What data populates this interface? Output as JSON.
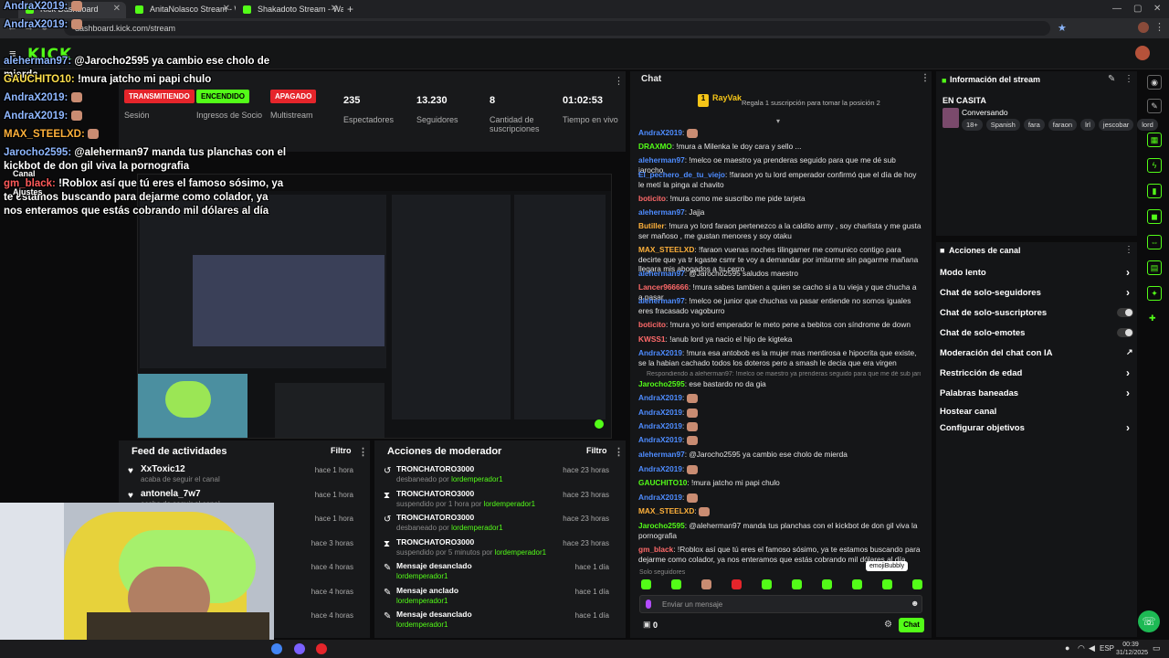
{
  "browser": {
    "tabs": [
      {
        "label": "Kick Dashboard"
      },
      {
        "label": "AnitaNolasco Stream - Watch L"
      },
      {
        "label": "Shakadoto Stream - Watch"
      }
    ],
    "url": "dashboard.kick.com/stream",
    "new_tab_symbol": "+"
  },
  "kick": {
    "logo": "KICK"
  },
  "stats": {
    "session": {
      "badge": "TRANSMITIENDO",
      "label": "Sesión"
    },
    "partner": {
      "badge": "ENCENDIDO",
      "label": "Ingresos de Socio"
    },
    "multistream": {
      "badge": "APAGADO",
      "label": "Multistream"
    },
    "viewers": {
      "value": "235",
      "label": "Espectadores"
    },
    "followers": {
      "value": "13.230",
      "label": "Seguidores"
    },
    "subs": {
      "value": "8",
      "label": "Cantidad de suscripciones"
    },
    "live_time": {
      "value": "01:02:53",
      "label": "Tiempo en vivo"
    }
  },
  "activity_feed": {
    "title": "Feed de actividades",
    "filter": "Filtro",
    "items": [
      {
        "name": "XxToxic12",
        "sub": "acaba de seguir el canal",
        "time": "hace 1 hora"
      },
      {
        "name": "antonela_7w7",
        "sub": "acaba de seguir el canal",
        "time": "hace 1 hora"
      },
      {
        "name": "",
        "sub": "",
        "time": "hace 1 hora"
      },
      {
        "name": "",
        "sub": "",
        "time": "hace 3 horas"
      },
      {
        "name": "",
        "sub": "",
        "time": "hace 4 horas"
      },
      {
        "name": "",
        "sub": "",
        "time": "hace 4 horas"
      },
      {
        "name": "",
        "sub": "",
        "time": "hace 4 horas"
      }
    ]
  },
  "mod_actions": {
    "title": "Acciones de moderador",
    "filter": "Filtro",
    "items": [
      {
        "title": "TRONCHATORO3000",
        "sub": "desbaneado por",
        "by": "lordemperador1",
        "time": "hace 23 horas"
      },
      {
        "title": "TRONCHATORO3000",
        "sub": "suspendido por 1 hora por",
        "by": "lordemperador1",
        "time": "hace 23 horas"
      },
      {
        "title": "TRONCHATORO3000",
        "sub": "desbaneado por",
        "by": "lordemperador1",
        "time": "hace 23 horas"
      },
      {
        "title": "TRONCHATORO3000",
        "sub": "suspendido por 5 minutos por",
        "by": "lordemperador1",
        "time": "hace 23 horas"
      },
      {
        "title": "Mensaje desanclado",
        "sub": "",
        "by": "lordemperador1",
        "time": "hace 1 día"
      },
      {
        "title": "Mensaje anclado",
        "sub": "",
        "by": "lordemperador1",
        "time": "hace 1 día"
      },
      {
        "title": "Mensaje desanclado",
        "sub": "",
        "by": "lordemperador1",
        "time": "hace 1 día"
      }
    ]
  },
  "chat": {
    "title": "Chat",
    "top_user": "RayVak",
    "top_rank": "1",
    "gift_prompt": "Regala 1 suscripción para tomar la posición 2",
    "messages": [
      {
        "user": "AndraX2019",
        "color": "#4e8cff",
        "text": ""
      },
      {
        "user": "DRAXMO",
        "color": "#53fc18",
        "text": "!mura a Milenka le doy cara y sello ..."
      },
      {
        "user": "aleherman97",
        "color": "#4e8cff",
        "text": "!melco oe maestro ya prenderas seguido para que me dé sub jarocho"
      },
      {
        "user": "El_pechero_de_tu_viejo",
        "color": "#4e8cff",
        "text": "!faraon yo tu lord emperador confirmó que el día de hoy le metí la pinga al chavito"
      },
      {
        "user": "boticito",
        "color": "#ff6a6a",
        "text": "!mura como me suscribo me pide tarjeta"
      },
      {
        "user": "aleherman97",
        "color": "#4e8cff",
        "text": "Jajja"
      },
      {
        "user": "Butiller",
        "color": "#ffb13b",
        "text": "!mura yo lord faraon pertenezco a la caldito army , soy charlista y me gusta ser mañoso , me gustan menores y soy otaku"
      },
      {
        "user": "MAX_STEELXD",
        "color": "#ffb13b",
        "text": "!faraon vuenas noches tilingamer me comunico contigo para decirte que ya tr kgaste csmr te voy a demandar por imitarme sin pagarme mañana llegara mis abogados a tu cerro"
      },
      {
        "user": "aleherman97",
        "color": "#4e8cff",
        "text": "@Jarocho2595 saludos maestro"
      },
      {
        "user": "Lancer966666",
        "color": "#ff6a6a",
        "text": "!mura sabes tambien a quien se cacho si a tu vieja y que chucha a a pasar"
      },
      {
        "user": "aleherman97",
        "color": "#4e8cff",
        "text": "!melco oe junior que chuchas va pasar entiende no somos iguales eres fracasado vagoburro"
      },
      {
        "user": "boticito",
        "color": "#ff6a6a",
        "text": "!mura yo lord emperador le meto pene a bebitos con síndrome de down"
      },
      {
        "user": "KWSS1",
        "color": "#ff6a6a",
        "text": "!anub lord ya nacio el hijo de kigteka"
      },
      {
        "user": "AndraX2019",
        "color": "#4e8cff",
        "text": "!mura esa antobob es la mujer mas mentirosa e hipocrita que existe, se la habian cachado todos los doteros pero a smash le decia que era virgen"
      },
      {
        "user": "Jarocho2595",
        "color": "#53fc18",
        "text": "ese bastardo no da gia"
      },
      {
        "user": "AndraX2019",
        "color": "#4e8cff",
        "text": ""
      },
      {
        "user": "AndraX2019",
        "color": "#4e8cff",
        "text": ""
      },
      {
        "user": "AndraX2019",
        "color": "#4e8cff",
        "text": ""
      },
      {
        "user": "AndraX2019",
        "color": "#4e8cff",
        "text": ""
      },
      {
        "user": "aleherman97",
        "color": "#4e8cff",
        "text": "@Jarocho2595 ya cambio ese cholo de mierda"
      },
      {
        "user": "AndraX2019",
        "color": "#4e8cff",
        "text": ""
      },
      {
        "user": "GAUCHITO10",
        "color": "#53fc18",
        "text": "!mura jatcho mi papi chulo"
      },
      {
        "user": "AndraX2019",
        "color": "#4e8cff",
        "text": ""
      },
      {
        "user": "MAX_STEELXD",
        "color": "#ffb13b",
        "text": ""
      },
      {
        "user": "Jarocho2595",
        "color": "#53fc18",
        "text": "@aleherman97 manda tus planchas con el kickbot de don gil viva la pornografia"
      },
      {
        "user": "gm_black",
        "color": "#ff6a6a",
        "text": "!Roblox así que tú eres el famoso sósimo, ya te estamos buscando para dejarme como colador, ya nos enteramos que estás cobrando mil dólares al día"
      }
    ],
    "reply_note": "Respondiendo a aleherman97: !melco oe maestro ya prenderas seguido para que me dé sub jarocho",
    "followers_only": "Solo seguidores",
    "emote_tooltip": "emojiBubbly",
    "input_placeholder": "Enviar un mensaje",
    "send_label": "Chat",
    "counter": "0"
  },
  "stream_info": {
    "title": "Información del stream",
    "status": "EN CASITA",
    "category": "Conversando",
    "tags": [
      "18+",
      "Spanish",
      "fara",
      "faraon",
      "lrl",
      "jescobar",
      "lord"
    ]
  },
  "channel_actions": {
    "title": "Acciones de canal",
    "items": [
      {
        "label": "Modo lento",
        "control": "chevron"
      },
      {
        "label": "Chat de solo-seguidores",
        "control": "chevron"
      },
      {
        "label": "Chat de solo-suscriptores",
        "control": "toggle"
      },
      {
        "label": "Chat de solo-emotes",
        "control": "toggle"
      },
      {
        "label": "Moderación del chat con IA",
        "control": "link"
      },
      {
        "label": "Restricción de edad",
        "control": "chevron"
      },
      {
        "label": "Palabras baneadas",
        "control": "chevron"
      },
      {
        "label": "Hostear canal",
        "control": "none"
      },
      {
        "label": "Configurar objetivos",
        "control": "chevron"
      }
    ]
  },
  "overlay": {
    "lines": [
      {
        "user": "AndraX2019:",
        "text": ""
      },
      {
        "user": "AndraX2019:",
        "text": ""
      },
      {
        "user": "aleherman97:",
        "text": "@Jarocho2595 ya cambio ese cholo de mierda"
      },
      {
        "user": "GAUCHITO10:",
        "text": "!mura jatcho mi papi chulo"
      },
      {
        "user": "AndraX2019:",
        "text": ""
      },
      {
        "user": "AndraX2019:",
        "text": ""
      },
      {
        "user": "MAX_STEELXD:",
        "text": ""
      },
      {
        "user": "Jarocho2595:",
        "text": "@aleherman97 manda tus planchas con el kickbot de don gil viva la pornografia"
      },
      {
        "user": "gm_black:",
        "text": "!Roblox así que tú eres el famoso sósimo, ya te estamos buscando para dejarme como colador, ya nos enteramos que estás cobrando mil dólares al día"
      }
    ],
    "menu_canal": "Canal",
    "menu_ajustes": "Ajustes"
  },
  "taskbar": {
    "lang": "ESP",
    "time": "00:39",
    "date": "31/12/2025"
  },
  "colors": {
    "accent": "#53fc18",
    "live_red": "#e5252b",
    "bg": "#18191b"
  }
}
